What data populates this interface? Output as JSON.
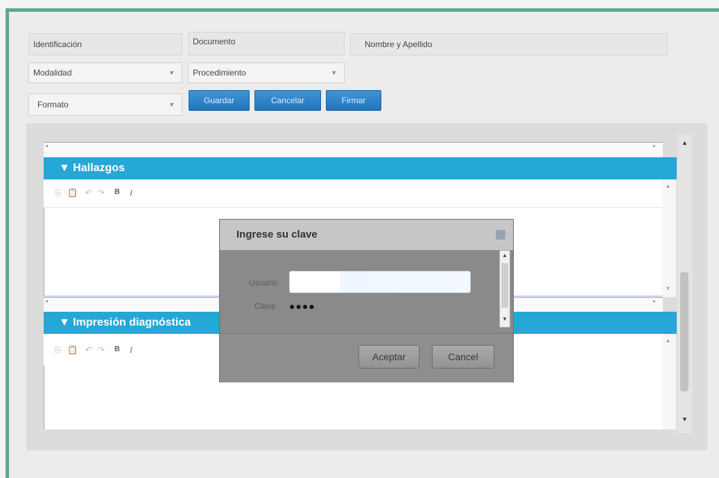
{
  "form": {
    "identificacion": "Identificación",
    "documento": "Documento",
    "nombre": "Nombre y Apellido",
    "modalidad": "Modalidad",
    "procedimiento": "Procedimiento",
    "formato": "Formato",
    "dropdown_arrow": "▼"
  },
  "actions": {
    "guardar": "Guardar",
    "cancelar": "Cancelar",
    "firmar": "Firmar"
  },
  "sections": {
    "hallazgos": "Hallazgos",
    "impresion": "Impresión diagnóstica",
    "toggle_icon": "▼"
  },
  "toolbar": {
    "copy_icon": "copy-icon",
    "paste_icon": "paste-icon",
    "undo_icon": "undo-icon",
    "redo_icon": "redo-icon",
    "bold": "B",
    "italic": "I"
  },
  "dialog": {
    "title": "Ingrese su clave",
    "usuario_label": "Usuario",
    "clave_label": "Clave",
    "clave_value": "●●●●",
    "aceptar": "Aceptar",
    "cancel": "Cancel"
  },
  "colors": {
    "accent": "#26a8d6",
    "frame": "#5fa594",
    "button": "#2a7fc2"
  }
}
